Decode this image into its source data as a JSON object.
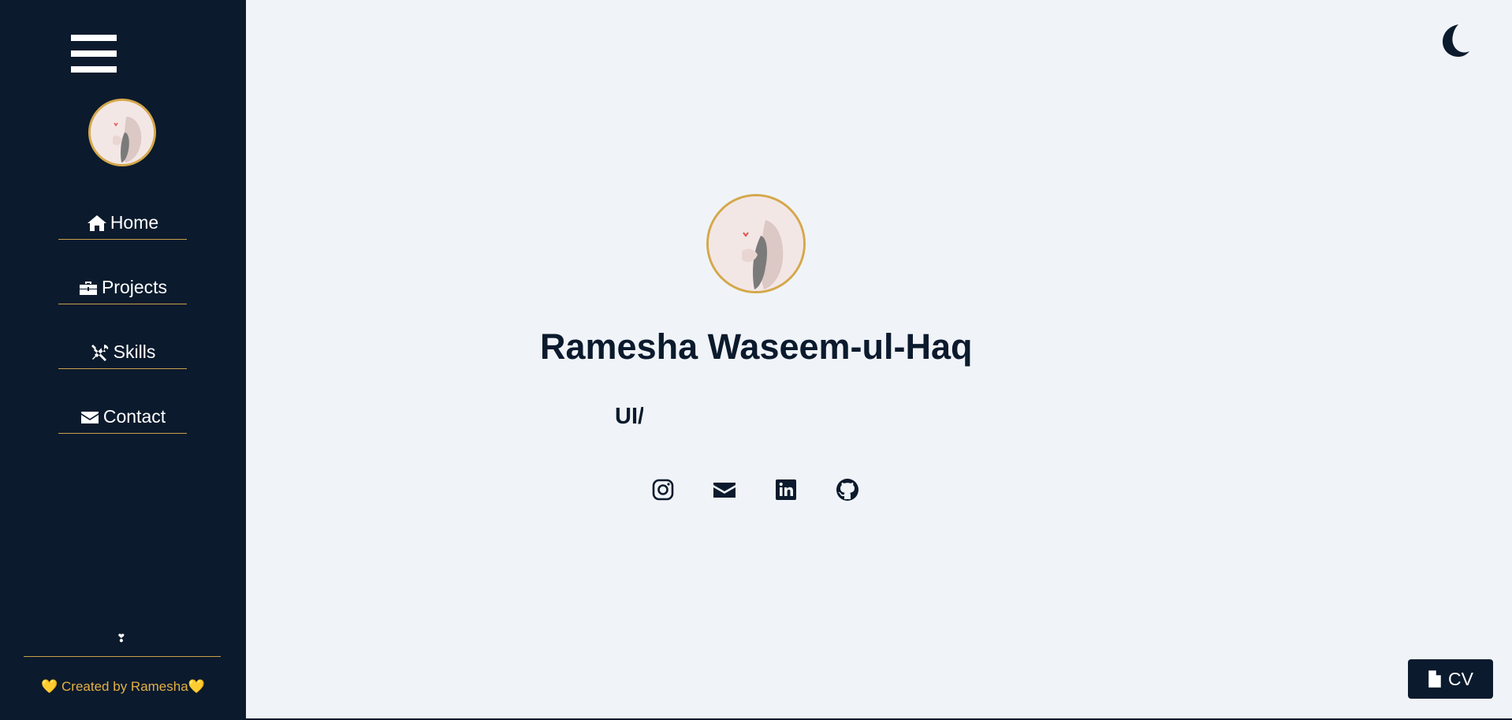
{
  "sidebar": {
    "nav": [
      {
        "label": "Home",
        "icon": "home-icon"
      },
      {
        "label": "Projects",
        "icon": "briefcase-icon"
      },
      {
        "label": "Skills",
        "icon": "tools-icon"
      },
      {
        "label": "Contact",
        "icon": "envelope-icon"
      }
    ],
    "small_symbol": "❣",
    "credit": "💛 Created by Ramesha💛"
  },
  "main": {
    "name": "Ramesha Waseem-ul-Haq",
    "role_typed": "UI/",
    "socials": [
      {
        "icon": "instagram-icon"
      },
      {
        "icon": "envelope-icon"
      },
      {
        "icon": "linkedin-icon"
      },
      {
        "icon": "github-icon"
      }
    ],
    "cv_label": "CV"
  },
  "colors": {
    "sidebar_bg": "#0b1a2d",
    "page_bg": "#f0f4f8",
    "accent_gold": "#d4a84b",
    "credit_text": "#e3b046"
  }
}
